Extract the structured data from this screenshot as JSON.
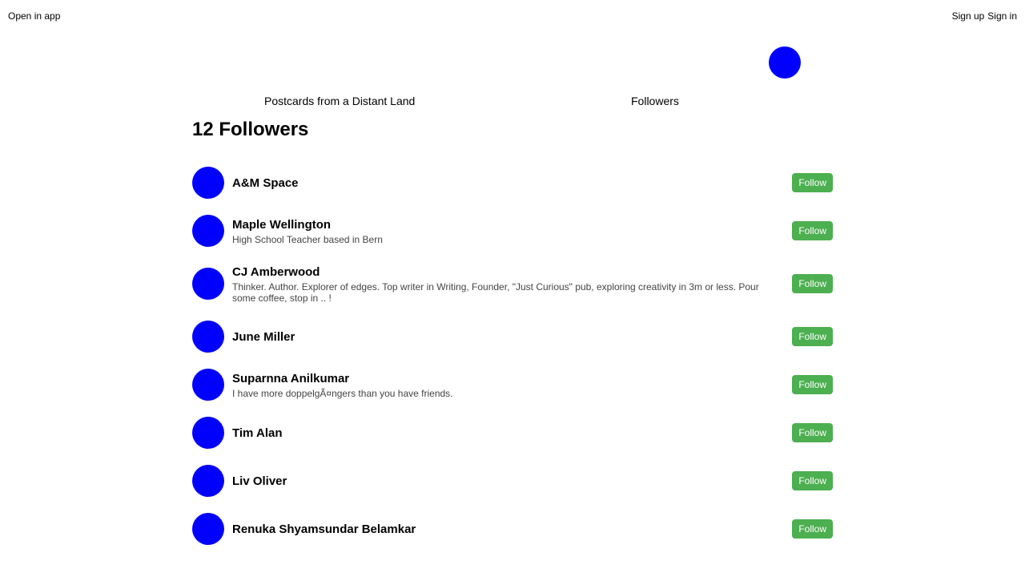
{
  "header": {
    "open_in_app": "Open in app",
    "sign_up": "Sign up",
    "sign_in": "Sign in"
  },
  "nav": {
    "publication": "Postcards from a Distant Land",
    "followers": "Followers"
  },
  "page_title": "12 Followers",
  "colors": {
    "avatar": "#0000ff",
    "follow_button": "#4caf50"
  },
  "followers": [
    {
      "name": "A&M Space",
      "bio": "",
      "button": "Follow"
    },
    {
      "name": "Maple Wellington",
      "bio": "High School Teacher based in Bern",
      "button": "Follow"
    },
    {
      "name": "CJ Amberwood",
      "bio": "Thinker. Author. Explorer of edges. Top writer in Writing, Founder, \"Just Curious\" pub, exploring creativity in 3m or less. Pour some coffee, stop in .. !",
      "button": "Follow"
    },
    {
      "name": "June Miller",
      "bio": "",
      "button": "Follow"
    },
    {
      "name": "Suparnna Anilkumar",
      "bio": "I have more doppelgÃ¤ngers than you have friends.",
      "button": "Follow"
    },
    {
      "name": "Tim Alan",
      "bio": "",
      "button": "Follow"
    },
    {
      "name": "Liv Oliver",
      "bio": "",
      "button": "Follow"
    },
    {
      "name": "Renuka Shyamsundar Belamkar",
      "bio": "",
      "button": "Follow"
    }
  ]
}
